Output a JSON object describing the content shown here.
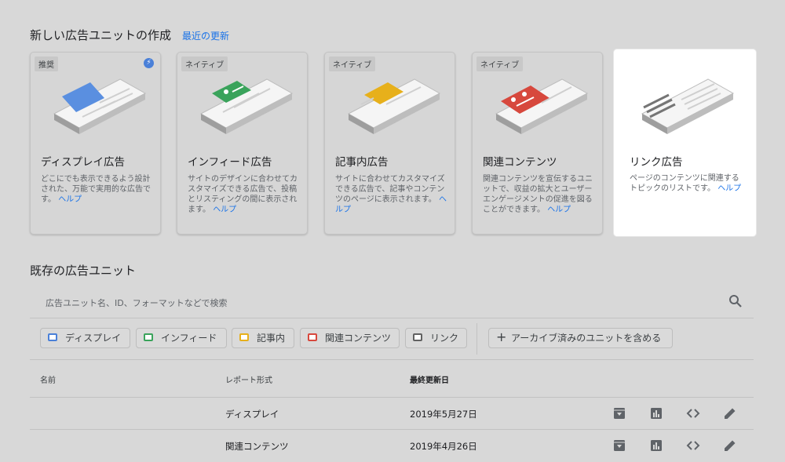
{
  "header": {
    "create_title": "新しい広告ユニットの作成",
    "recent_updates_link": "最近の更新"
  },
  "cards": [
    {
      "tag": "推奨",
      "title": "ディスプレイ広告",
      "desc": "どこにでも表示できるよう設計された、万能で実用的な広告です。",
      "help": "ヘルプ",
      "accent": "#5a8fe0"
    },
    {
      "tag": "ネイティブ",
      "title": "インフィード広告",
      "desc": "サイトのデザインに合わせてカスタマイズできる広告で、投稿とリスティングの間に表示されます。",
      "help": "ヘルプ",
      "accent": "#3aa35b"
    },
    {
      "tag": "ネイティブ",
      "title": "記事内広告",
      "desc": "サイトに合わせてカスタマイズできる広告で、記事やコンテンツのページに表示されます。",
      "help": "ヘルプ",
      "accent": "#e7b01b"
    },
    {
      "tag": "ネイティブ",
      "title": "関連コンテンツ",
      "desc": "関連コンテンツを宣伝するユニットで、収益の拡大とユーザー エンゲージメントの促進を図ることができます。",
      "help": "ヘルプ",
      "accent": "#d7483d"
    },
    {
      "tag": "",
      "title": "リンク広告",
      "desc": "ページのコンテンツに関連するトピックのリストです。",
      "help": "ヘルプ",
      "accent": "#757575"
    }
  ],
  "existing": {
    "title": "既存の広告ユニット",
    "search_placeholder": "広告ユニット名、ID、フォーマットなどで検索"
  },
  "filters": [
    {
      "label": "ディスプレイ",
      "color": "#4a80d8"
    },
    {
      "label": "インフィード",
      "color": "#3aa35b"
    },
    {
      "label": "記事内",
      "color": "#e7b01b"
    },
    {
      "label": "関連コンテンツ",
      "color": "#d7483d"
    },
    {
      "label": "リンク",
      "color": "#616161"
    }
  ],
  "archive_toggle": "アーカイブ済みのユニットを含める",
  "table": {
    "headers": [
      "名前",
      "レポート形式",
      "最終更新日"
    ],
    "rows": [
      {
        "name": "",
        "format": "ディスプレイ",
        "updated": "2019年5月27日"
      },
      {
        "name": "",
        "format": "関連コンテンツ",
        "updated": "2019年4月26日"
      }
    ]
  },
  "icons": [
    "bolt-icon",
    "search-icon",
    "archive-icon",
    "report-icon",
    "code-icon",
    "edit-icon"
  ]
}
